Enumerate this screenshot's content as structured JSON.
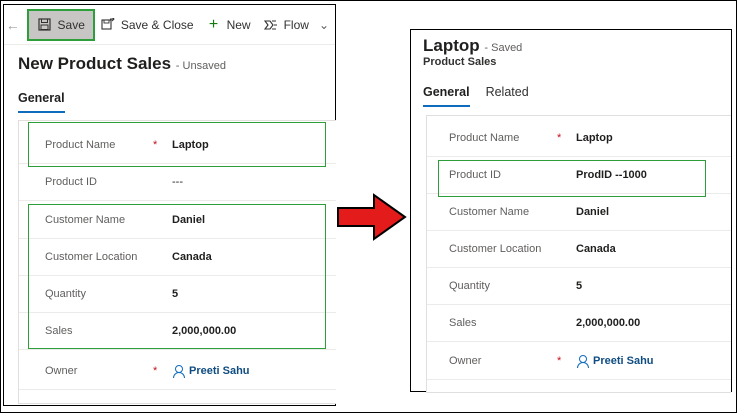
{
  "left": {
    "toolbar": {
      "back_icon": "back-arrow-icon",
      "save_label": "Save",
      "save_close_label": "Save & Close",
      "new_label": "New",
      "flow_label": "Flow"
    },
    "title": "New Product Sales",
    "status": "- Unsaved",
    "tabs": [
      "General"
    ],
    "fields": [
      {
        "label": "Product Name",
        "required": "*",
        "value": "Laptop"
      },
      {
        "label": "Product ID",
        "required": "",
        "value": "---"
      },
      {
        "label": "Customer Name",
        "required": "",
        "value": "Daniel"
      },
      {
        "label": "Customer Location",
        "required": "",
        "value": "Canada"
      },
      {
        "label": "Quantity",
        "required": "",
        "value": "5"
      },
      {
        "label": "Sales",
        "required": "",
        "value": "2,000,000.00"
      },
      {
        "label": "Owner",
        "required": "*",
        "value": "Preeti Sahu"
      }
    ]
  },
  "right": {
    "title": "Laptop",
    "status": "- Saved",
    "entity": "Product Sales",
    "tabs": [
      "General",
      "Related"
    ],
    "fields": [
      {
        "label": "Product Name",
        "required": "*",
        "value": "Laptop"
      },
      {
        "label": "Product ID",
        "required": "",
        "value": "ProdID --1000"
      },
      {
        "label": "Customer Name",
        "required": "",
        "value": "Daniel"
      },
      {
        "label": "Customer Location",
        "required": "",
        "value": "Canada"
      },
      {
        "label": "Quantity",
        "required": "",
        "value": "5"
      },
      {
        "label": "Sales",
        "required": "",
        "value": "2,000,000.00"
      },
      {
        "label": "Owner",
        "required": "*",
        "value": "Preeti Sahu"
      }
    ]
  },
  "colors": {
    "highlight": "#2e9e3a",
    "arrow": "#e31b1b",
    "accent": "#0f6cbd"
  }
}
